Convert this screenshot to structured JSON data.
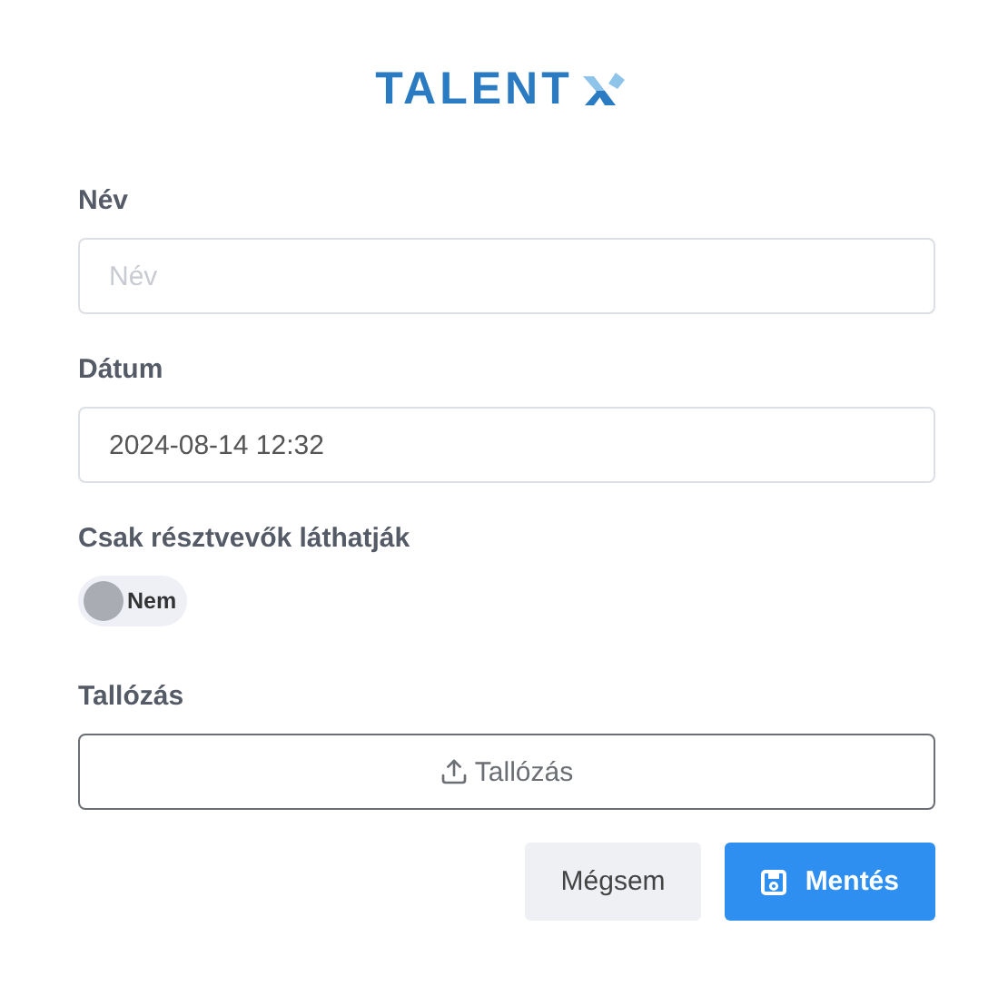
{
  "logo": {
    "text": "TALENT"
  },
  "fields": [
    {
      "label": "Név",
      "placeholder": "Név"
    },
    {
      "label": "Dátum",
      "value": "2024-08-14 12:32"
    }
  ],
  "visibility": {
    "label": "Csak résztvevők láthatják",
    "on": false,
    "state_text": "Nem"
  },
  "browse": {
    "label": "Tallózás",
    "button": "Tallózás"
  },
  "buttons": [
    {
      "kind": "cancel",
      "label": "Mégsem"
    },
    {
      "kind": "save",
      "label": "Mentés"
    }
  ]
}
